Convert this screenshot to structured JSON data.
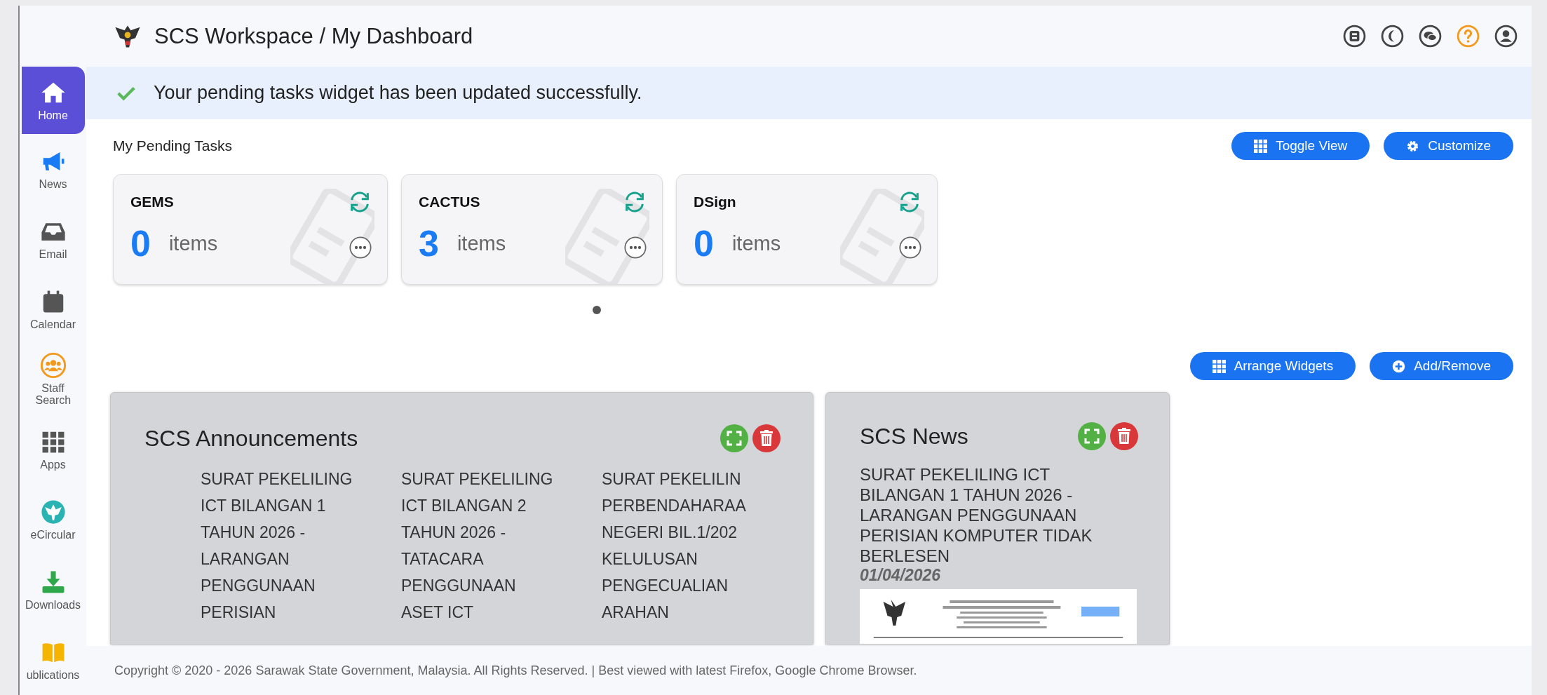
{
  "header": {
    "title": "SCS Workspace / My Dashboard"
  },
  "sidebar": {
    "items": [
      {
        "label": "Home",
        "selected": true
      },
      {
        "label": "News",
        "selected": false
      },
      {
        "label": "Email",
        "selected": false
      },
      {
        "label": "Calendar",
        "selected": false
      },
      {
        "label": "Staff Search",
        "selected": false
      },
      {
        "label": "Apps",
        "selected": false
      },
      {
        "label": "eCircular",
        "selected": false
      },
      {
        "label": "Downloads",
        "selected": false
      },
      {
        "label": "ublications",
        "selected": false
      }
    ]
  },
  "alert": {
    "message": "Your pending tasks widget has been updated successfully."
  },
  "pending_tasks": {
    "title": "My Pending Tasks",
    "buttons": [
      "Toggle View",
      "Customize"
    ],
    "cards": [
      {
        "name": "GEMS",
        "count": "0",
        "unit": "items"
      },
      {
        "name": "CACTUS",
        "count": "3",
        "unit": "items"
      },
      {
        "name": "DSign",
        "count": "0",
        "unit": "items"
      }
    ]
  },
  "widget_buttons": [
    "Arrange Widgets",
    "Add/Remove"
  ],
  "announcements": {
    "title": "SCS Announcements",
    "items": [
      {
        "lines": [
          "SURAT PEKELILING",
          "ICT BILANGAN 1",
          "TAHUN 2026 -",
          "LARANGAN",
          "PENGGUNAAN",
          "PERISIAN"
        ]
      },
      {
        "lines": [
          "SURAT PEKELILING",
          "ICT BILANGAN 2",
          "TAHUN 2026 -",
          "TATACARA",
          "PENGGUNAAN",
          "ASET ICT"
        ]
      },
      {
        "lines": [
          "SURAT PEKELILIN",
          "PERBENDAHARAA",
          "NEGERI BIL.1/202",
          "KELULUSAN",
          "PENGECUALIAN",
          "ARAHAN"
        ]
      }
    ]
  },
  "news": {
    "title": "SCS News",
    "headline": "SURAT PEKELILING ICT BILANGAN 1 TAHUN 2026 - LARANGAN PENGGUNAAN PERISIAN KOMPUTER TIDAK BERLESEN",
    "date": "01/04/2026"
  },
  "footer": {
    "text": "Copyright © 2020 - 2026 Sarawak State Government, Malaysia. All Rights Reserved. | Best viewed with latest Firefox, Google Chrome Browser."
  }
}
